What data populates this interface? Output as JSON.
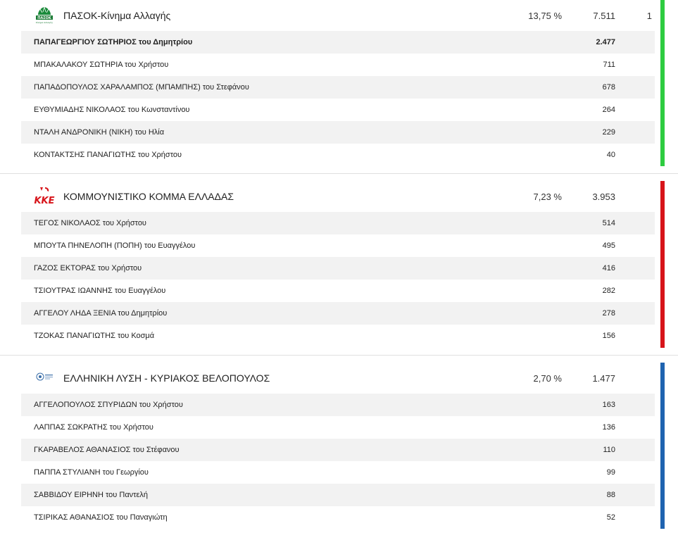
{
  "parties": [
    {
      "name": "ΠΑΣΟΚ-Κίνημα Αλλαγής",
      "pct": "13,75 %",
      "votes": "7.511",
      "seats": "1",
      "color": "#2ecc40",
      "logo_icon": "pasok-logo-icon",
      "logo_text": "ΠΑΣΟΚ",
      "logo_subtext": "Κίνημα Αλλαγής",
      "candidates": [
        {
          "name": "ΠΑΠΑΓΕΩΡΓΙΟΥ ΣΩΤΗΡΙΟΣ του Δημητρίου",
          "votes": "2.477",
          "elected": true
        },
        {
          "name": "ΜΠΑΚΑΛΑΚΟΥ ΣΩΤΗΡΙΑ του Χρήστου",
          "votes": "711"
        },
        {
          "name": "ΠΑΠΑΔΟΠΟΥΛΟΣ ΧΑΡΑΛΑΜΠΟΣ (ΜΠΑΜΠΗΣ) του Στεφάνου",
          "votes": "678"
        },
        {
          "name": "ΕΥΘΥΜΙΑΔΗΣ ΝΙΚΟΛΑΟΣ του Κωνσταντίνου",
          "votes": "264"
        },
        {
          "name": "ΝΤΑΛΗ ΑΝΔΡΟΝΙΚΗ (ΝΙΚΗ) του Ηλία",
          "votes": "229"
        },
        {
          "name": "ΚΟΝΤΑΚΤΣΗΣ ΠΑΝΑΓΙΩΤΗΣ του Χρήστου",
          "votes": "40"
        }
      ]
    },
    {
      "name": "ΚΟΜΜΟΥΝΙΣΤΙΚΟ ΚΟΜΜΑ ΕΛΛΑΔΑΣ",
      "pct": "7,23 %",
      "votes": "3.953",
      "seats": "",
      "color": "#d7141a",
      "logo_icon": "kke-logo-icon",
      "logo_text": "ΚΚΕ",
      "candidates": [
        {
          "name": "ΤΕΓΟΣ ΝΙΚΟΛΑΟΣ του Χρήστου",
          "votes": "514"
        },
        {
          "name": "ΜΠΟΥΤΑ ΠΗΝΕΛΟΠΗ (ΠΟΠΗ) του Ευαγγέλου",
          "votes": "495"
        },
        {
          "name": "ΓΑΖΟΣ ΕΚΤΟΡΑΣ του Χρήστου",
          "votes": "416"
        },
        {
          "name": "ΤΣΙΟΥΤΡΑΣ ΙΩΑΝΝΗΣ του Ευαγγέλου",
          "votes": "282"
        },
        {
          "name": "ΑΓΓΕΛΟΥ ΛΗΔΑ ΞΕΝΙΑ του Δημητρίου",
          "votes": "278"
        },
        {
          "name": "ΤΖΟΚΑΣ ΠΑΝΑΓΙΩΤΗΣ του Κοσμά",
          "votes": "156"
        }
      ]
    },
    {
      "name": "ΕΛΛΗΝΙΚΗ ΛΥΣΗ - ΚΥΡΙΑΚΟΣ ΒΕΛΟΠΟΥΛΟΣ",
      "pct": "2,70 %",
      "votes": "1.477",
      "seats": "",
      "color": "#1f63b0",
      "logo_icon": "elliniki-lysi-logo-icon",
      "logo_text": "",
      "candidates": [
        {
          "name": "ΑΓΓΕΛΟΠΟΥΛΟΣ ΣΠΥΡΙΔΩΝ του Χρήστου",
          "votes": "163"
        },
        {
          "name": "ΛΑΠΠΑΣ ΣΩΚΡΑΤΗΣ του Χρήστου",
          "votes": "136"
        },
        {
          "name": "ΓΚΑΡΑΒΕΛΟΣ ΑΘΑΝΑΣΙΟΣ του Στέφανου",
          "votes": "110"
        },
        {
          "name": "ΠΑΠΠΑ ΣΤΥΛΙΑΝΗ του Γεωργίου",
          "votes": "99"
        },
        {
          "name": "ΣΑΒΒΙΔΟΥ ΕΙΡΗΝΗ του Παντελή",
          "votes": "88"
        },
        {
          "name": "ΤΣΙΡΙΚΑΣ ΑΘΑΝΑΣΙΟΣ του Παναγιώτη",
          "votes": "52"
        }
      ]
    }
  ]
}
